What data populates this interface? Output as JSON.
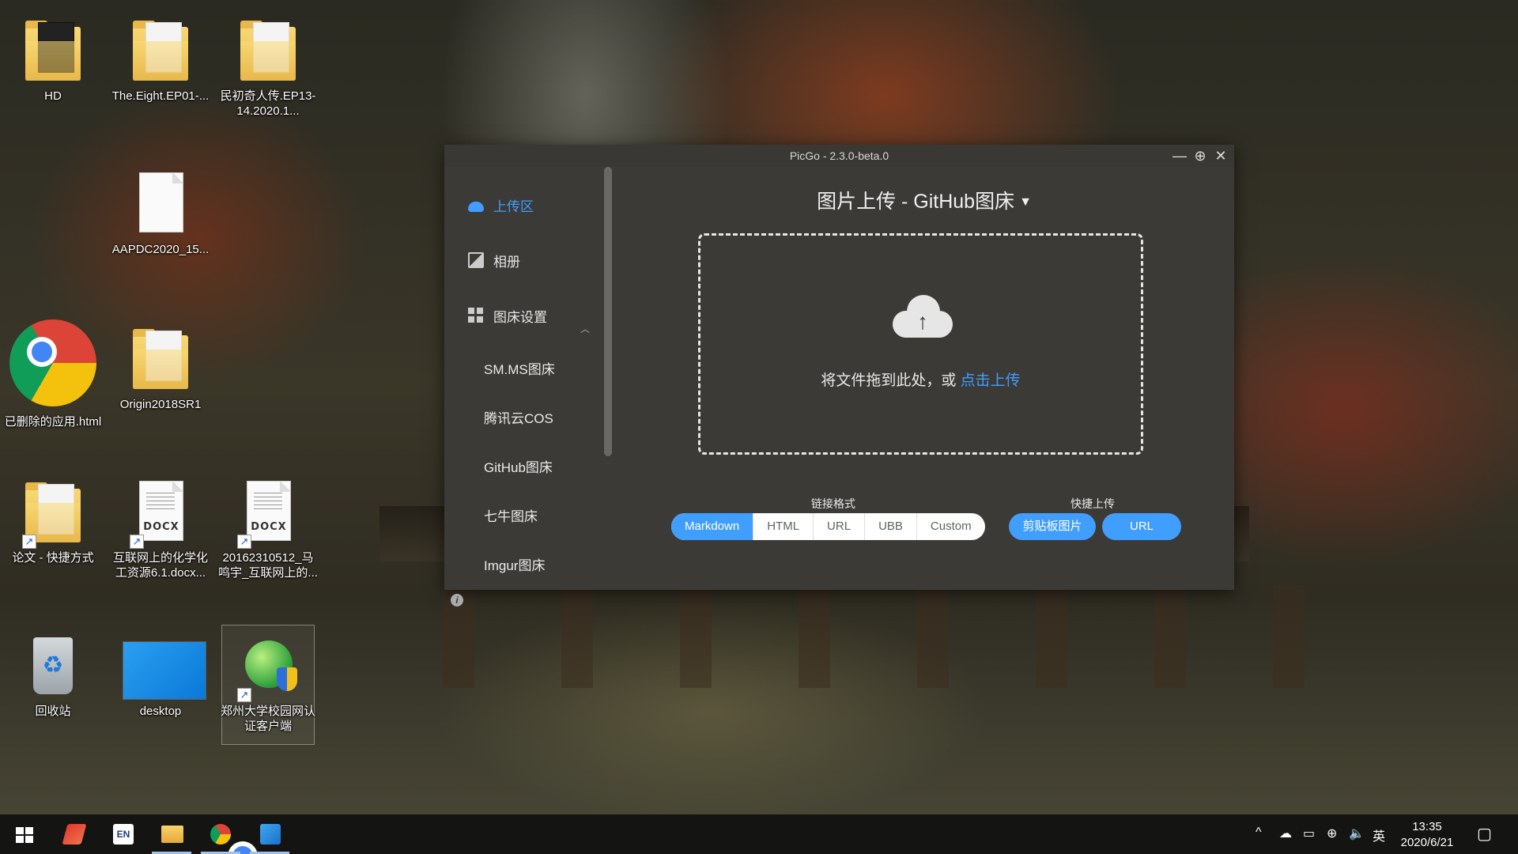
{
  "desktop": {
    "icons": [
      {
        "label": "HD"
      },
      {
        "label": "The.Eight.EP01-..."
      },
      {
        "label": "民初奇人传.EP13-14.2020.1..."
      },
      {
        "label": "AAPDC2020_15..."
      },
      {
        "label": "已删除的应用.html"
      },
      {
        "label": "Origin2018SR1"
      },
      {
        "label": "论文 - 快捷方式"
      },
      {
        "label": "互联网上的化学化工资源6.1.docx..."
      },
      {
        "label": "20162310512_马鸣宇_互联网上的..."
      },
      {
        "label": "回收站"
      },
      {
        "label": "desktop"
      },
      {
        "label": "郑州大学校园网认证客户端"
      }
    ],
    "docx_tag": "DOCX"
  },
  "window": {
    "title": "PicGo - 2.3.0-beta.0",
    "controls": {
      "minimize": "—",
      "pin": "⊕",
      "close": "✕"
    }
  },
  "sidebar": {
    "items": [
      {
        "label": "上传区",
        "icon": "cloud-upload-icon",
        "active": true
      },
      {
        "label": "相册",
        "icon": "image-icon"
      },
      {
        "label": "图床设置",
        "icon": "grid-icon"
      }
    ],
    "sub_items": [
      {
        "label": "SM.MS图床"
      },
      {
        "label": "腾讯云COS"
      },
      {
        "label": "GitHub图床"
      },
      {
        "label": "七牛图床"
      },
      {
        "label": "Imgur图床"
      }
    ],
    "info": "i"
  },
  "main": {
    "title": "图片上传 - GitHub图床",
    "caret": "▼",
    "drop_text": "将文件拖到此处，或 ",
    "drop_link": "点击上传",
    "link_format_label": "链接格式",
    "quick_upload_label": "快捷上传",
    "formats": [
      "Markdown",
      "HTML",
      "URL",
      "UBB",
      "Custom"
    ],
    "selected_format": "Markdown",
    "quick_buttons": [
      "剪贴板图片",
      "URL"
    ]
  },
  "taskbar": {
    "time": "13:35",
    "date": "2020/6/21",
    "ime": "英",
    "pinned": [
      "start-button",
      "app-red",
      "input-method-en",
      "file-explorer",
      "chrome",
      "picgo"
    ],
    "en_badge": "EN"
  },
  "colors": {
    "accent": "#409eff",
    "window_bg": "#3c3a36"
  }
}
